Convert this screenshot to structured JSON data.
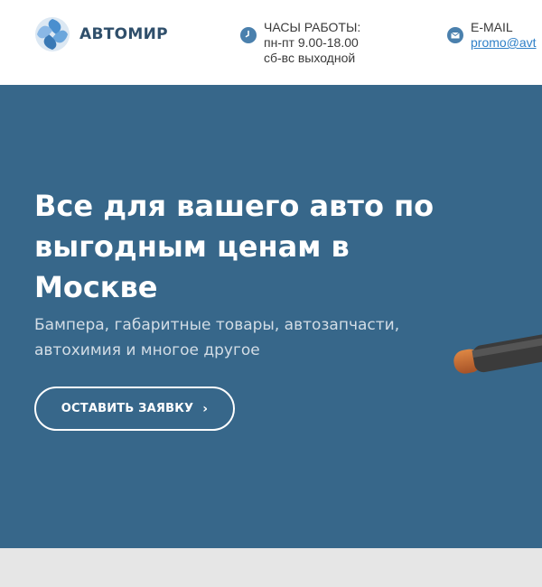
{
  "brand": {
    "name": "АВТОМИР"
  },
  "header": {
    "hours": {
      "title": "ЧАСЫ РАБОТЫ:",
      "weekdays": "пн-пт 9.00-18.00",
      "weekend": "сб-вс выходной"
    },
    "email": {
      "title": "E-MAIL",
      "address": "promo@avt"
    }
  },
  "hero": {
    "title": "Все для вашего авто по выгодным ценам в Москве",
    "subtitle": "Бампера, габаритные товары, автозапчасти, автохимия и многое другое",
    "cta_label": "ОСТАВИТЬ ЗАЯВКУ",
    "cta_chevron": "›"
  },
  "colors": {
    "hero_bg": "#37678a",
    "accent": "#4a80ad",
    "link": "#2f80c8",
    "lower_strip": "#e6e6e6"
  },
  "icons": [
    "logo-icon",
    "clock-icon",
    "mail-icon",
    "chevron-right-icon"
  ]
}
